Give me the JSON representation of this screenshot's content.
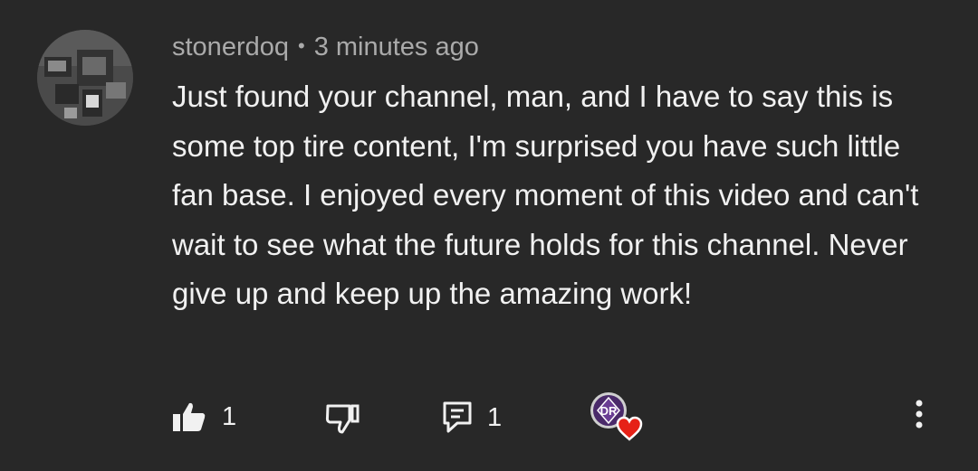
{
  "comment": {
    "author": "stonerdoq",
    "separator": "•",
    "time": "3 minutes ago",
    "text": "Just found your channel, man, and I have to say this is some top tire content, I'm surprised you have such little fan base. I enjoyed every moment of this video and can't wait to see what the future holds for this channel. Never give up and keep up the amazing work!"
  },
  "actions": {
    "like_count": "1",
    "reply_count": "1",
    "creator_avatar_text": "DR"
  },
  "icons": {
    "like": "thumbs-up-icon",
    "dislike": "thumbs-down-icon",
    "reply": "comment-icon",
    "heart": "heart-icon",
    "more": "more-vertical-icon"
  },
  "colors": {
    "background": "#282828",
    "text": "#f1f1f1",
    "meta": "#aaaaaa",
    "heart": "#e62117",
    "creator_avatar": "#4a2a6a"
  }
}
